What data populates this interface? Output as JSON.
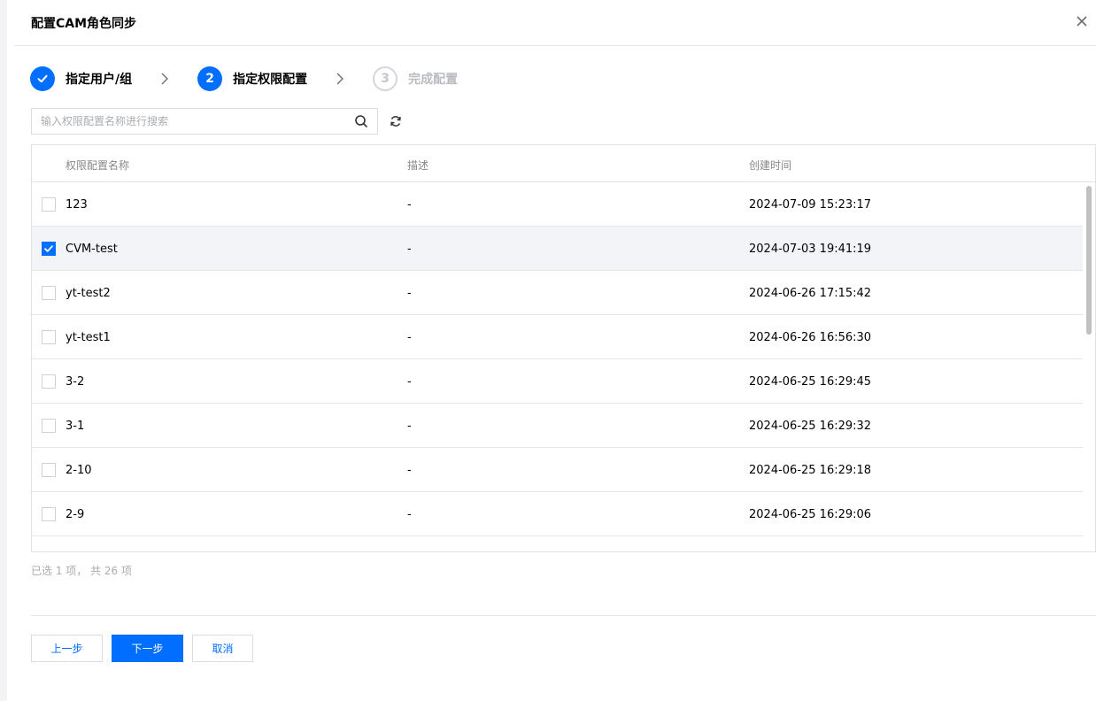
{
  "dialog": {
    "title": "配置CAM角色同步",
    "close_icon": "close-icon"
  },
  "steps": [
    {
      "label": "指定用户/组",
      "state": "done",
      "icon": "check-icon"
    },
    {
      "label": "指定权限配置",
      "state": "active",
      "number": "2"
    },
    {
      "label": "完成配置",
      "state": "pending",
      "number": "3"
    }
  ],
  "search": {
    "placeholder": "输入权限配置名称进行搜索",
    "value": ""
  },
  "table": {
    "columns": [
      "权限配置名称",
      "描述",
      "创建时间"
    ],
    "rows": [
      {
        "name": "123",
        "desc": "-",
        "created": "2024-07-09 15:23:17",
        "checked": false
      },
      {
        "name": "CVM-test",
        "desc": "-",
        "created": "2024-07-03 19:41:19",
        "checked": true
      },
      {
        "name": "yt-test2",
        "desc": "-",
        "created": "2024-06-26 17:15:42",
        "checked": false
      },
      {
        "name": "yt-test1",
        "desc": "-",
        "created": "2024-06-26 16:56:30",
        "checked": false
      },
      {
        "name": "3-2",
        "desc": "-",
        "created": "2024-06-25 16:29:45",
        "checked": false
      },
      {
        "name": "3-1",
        "desc": "-",
        "created": "2024-06-25 16:29:32",
        "checked": false
      },
      {
        "name": "2-10",
        "desc": "-",
        "created": "2024-06-25 16:29:18",
        "checked": false
      },
      {
        "name": "2-9",
        "desc": "-",
        "created": "2024-06-25 16:29:06",
        "checked": false
      },
      {
        "name": "",
        "desc": "",
        "created": "",
        "checked": false
      }
    ]
  },
  "summary": "已选 1 项， 共 26 项",
  "footer": {
    "prev_label": "上一步",
    "next_label": "下一步",
    "cancel_label": "取消"
  },
  "colors": {
    "primary": "#006eff",
    "selected_row": "#f3f4f7",
    "disabled_text": "#b8bbc0"
  }
}
